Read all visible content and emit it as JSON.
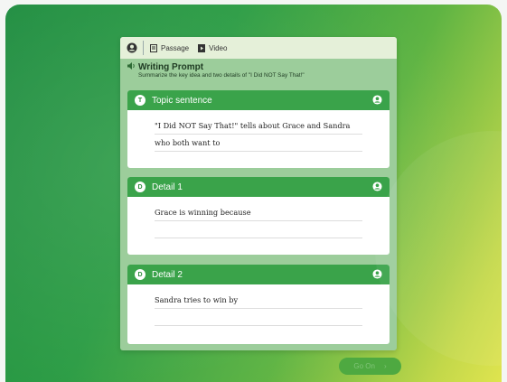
{
  "toolbar": {
    "passage_label": "Passage",
    "video_label": "Video"
  },
  "prompt": {
    "title": "Writing Prompt",
    "subtitle": "Summarize the key idea and two details of \"I Did NOT Say That!\""
  },
  "cards": [
    {
      "badge": "T",
      "title": "Topic sentence",
      "lines": [
        "\"I Did NOT Say That!\" tells about Grace and Sandra",
        "who both want to"
      ]
    },
    {
      "badge": "D",
      "title": "Detail 1",
      "lines": [
        "Grace is winning because",
        ""
      ]
    },
    {
      "badge": "D",
      "title": "Detail 2",
      "lines": [
        "Sandra tries to win by",
        ""
      ]
    }
  ],
  "go_on": {
    "label": "Go On",
    "arrow": "›"
  },
  "icons": {
    "user": "user-circle-icon",
    "passage": "document-icon",
    "video": "video-icon",
    "speaker": "speaker-icon"
  },
  "colors": {
    "card_header": "#3aa34a",
    "toolbar": "#e5f0d9",
    "panel": "#9ccd9b"
  }
}
